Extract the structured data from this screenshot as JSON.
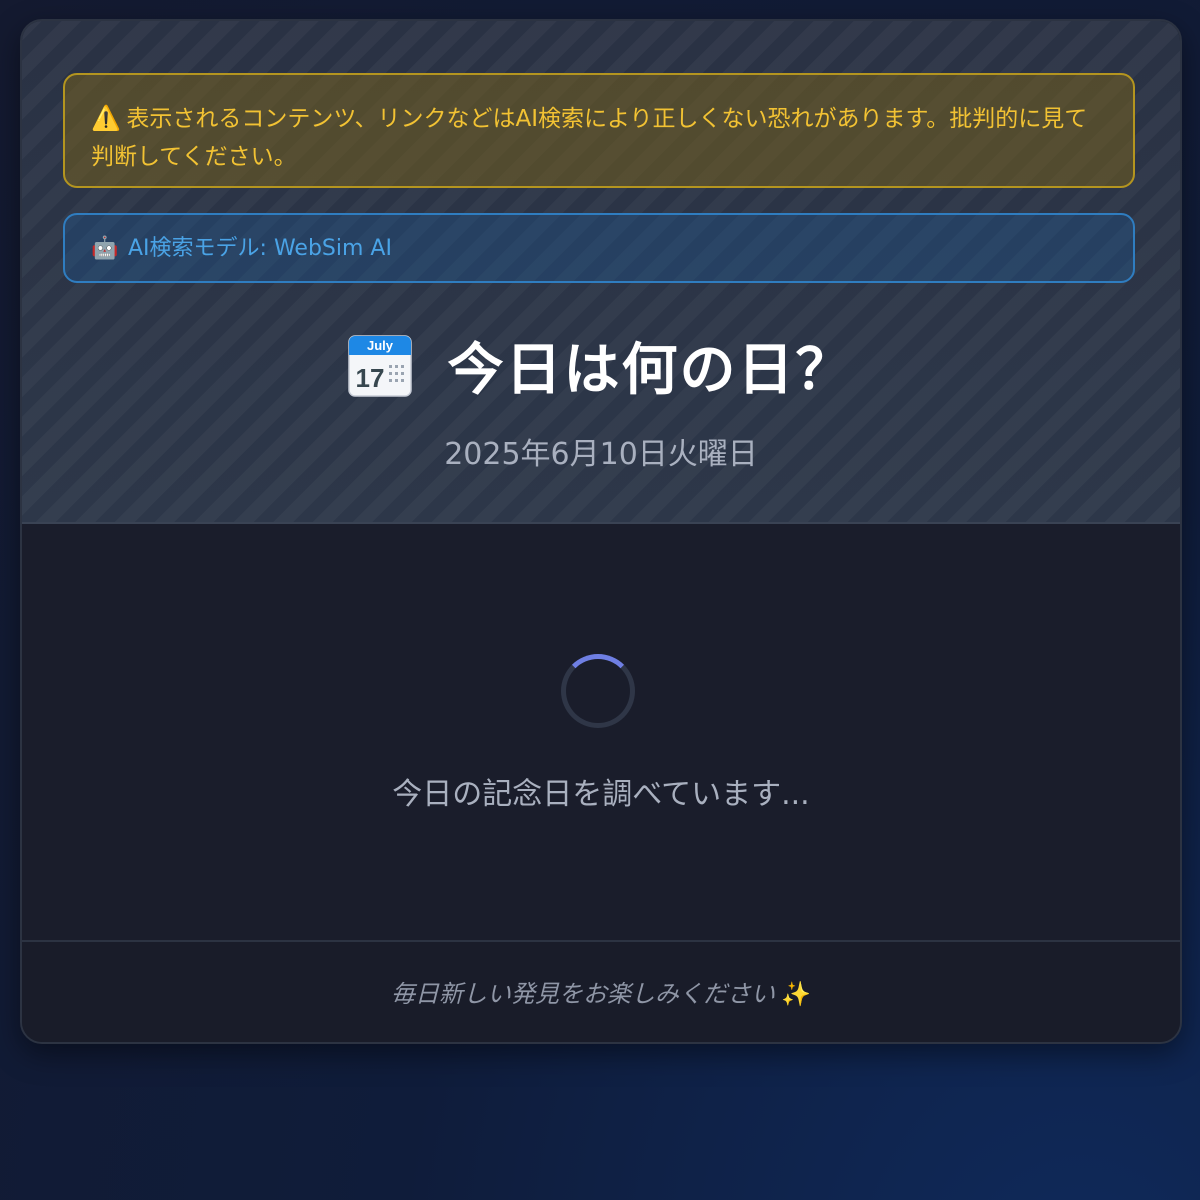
{
  "warning": {
    "icon": "warning-icon",
    "text": "表示されるコンテンツ、リンクなどはAI検索により正しくない恐れがあります。批判的に見て判断してください。"
  },
  "model": {
    "icon": "robot-icon",
    "text": "AI検索モデル: WebSim AI"
  },
  "header": {
    "calendar_month": "July",
    "calendar_day": "17",
    "title": "今日は何の日？",
    "date": "2025年6月10日火曜日"
  },
  "loading": {
    "text": "今日の記念日を調べています..."
  },
  "footer": {
    "text": "毎日新しい発見をお楽しみください",
    "icon": "sparkle-icon"
  },
  "colors": {
    "warning_text": "#f2c233",
    "model_text": "#4aa3e6",
    "spinner_accent": "#6f7fe3"
  }
}
